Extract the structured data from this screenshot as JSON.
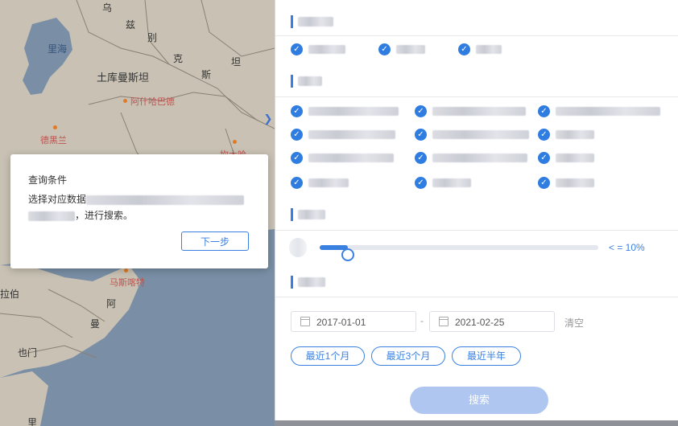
{
  "map": {
    "labels": {
      "wu": "乌",
      "zi": "兹",
      "bie": "别",
      "ke": "克",
      "tan": "坦",
      "caspian": "里海",
      "turkmenistan": "土库曼斯坦",
      "si": "斯",
      "ashgabat": "阿什哈巴德",
      "tehran": "德黑兰",
      "kandahar": "坎大哈",
      "muscat": "马斯喀特",
      "arabia": "拉伯",
      "a": "阿",
      "man": "曼",
      "yemen": "也门",
      "li": "里"
    },
    "colors": {
      "land": "#c9c2b4",
      "water": "#7a8fa6",
      "border": "#8a7f74"
    }
  },
  "tour": {
    "title": "查询条件",
    "description_prefix": "选择对应数据",
    "description_suffix": "，进行搜索。",
    "next_button": "下一步"
  },
  "panel": {
    "slider": {
      "value_label": "< = 10%",
      "level": 0.1
    },
    "date": {
      "start": "2017-01-01",
      "separator": "-",
      "end": "2021-02-25",
      "clear": "清空"
    },
    "quick_ranges": [
      "最近1个月",
      "最近3个月",
      "最近半年"
    ],
    "search_button": "搜索"
  },
  "colors": {
    "accent": "#3a80e0",
    "search_disabled": "#aec6f0"
  }
}
